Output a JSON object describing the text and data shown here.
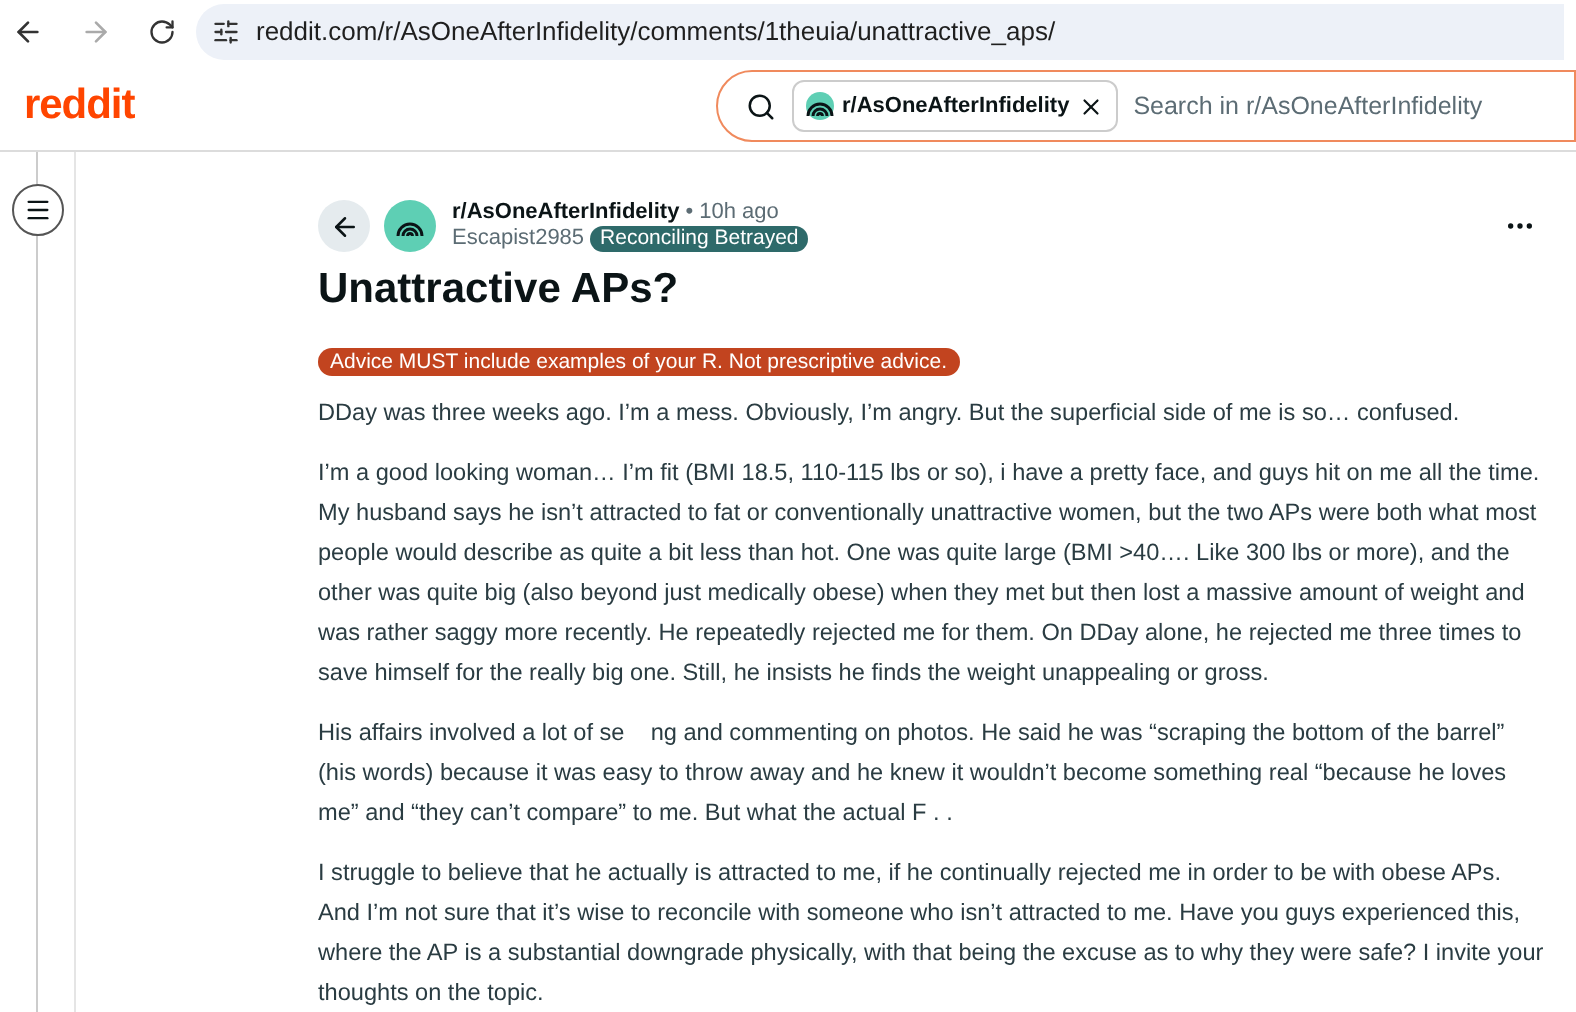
{
  "browser": {
    "url": "reddit.com/r/AsOneAfterInfidelity/comments/1theuia/unattractive_aps/"
  },
  "header": {
    "logo": "reddit",
    "search": {
      "community_chip": "r/AsOneAfterInfidelity",
      "placeholder": "Search in r/AsOneAfterInfidelity"
    }
  },
  "post": {
    "subreddit": "r/AsOneAfterInfidelity",
    "time": "• 10h ago",
    "author": "Escapist2985",
    "flair": "Reconciling Betrayed",
    "title": "Unattractive APs?",
    "rule_flair": "Advice MUST include examples of your R. Not prescriptive advice.",
    "paragraphs": [
      "DDay was three weeks ago. I’m a mess. Obviously, I’m angry. But the superficial side of me is so… confused.",
      "I’m a good looking woman… I’m fit (BMI 18.5, 110-115 lbs or so), i have a pretty face, and guys hit on me all the time. My husband says he isn’t attracted to fat or conventionally unattractive women, but the two APs were both what most people would describe as quite a bit less than hot. One was quite large (BMI >40…. Like 300 lbs or more), and the other was quite big (also beyond just medically obese) when they met but then lost a massive amount of weight and was rather saggy more recently. He repeatedly rejected me for them. On DDay alone, he rejected me three times to save himself for the really big one. Still, he insists he finds the weight unappealing or gross.",
      "His affairs involved a lot of se    ng and commenting on photos. He said he was “scraping the bottom of the barrel” (his words) because it was easy to throw away and he knew it wouldn’t become something real “because he loves me” and “they can’t compare” to me. But what the actual F . .",
      "I struggle to believe that he actually is attracted to me, if he continually rejected me in order to be with obese APs. And I’m not sure that it’s wise to reconcile with someone who isn’t attracted to me. Have you guys experienced this, where the AP is a substantial downgrade physically, with that being the excuse as to why they were safe? I invite your thoughts on the topic."
    ]
  }
}
